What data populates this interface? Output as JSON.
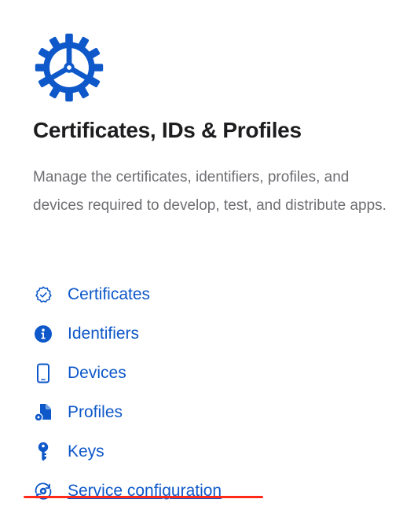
{
  "header": {
    "icon": "gear-icon",
    "title": "Certificates, IDs & Profiles",
    "description": "Manage the certificates, identifiers, profiles, and devices required to develop, test, and distribute apps."
  },
  "nav": {
    "items": [
      {
        "label": "Certificates",
        "icon": "certificate-badge-icon"
      },
      {
        "label": "Identifiers",
        "icon": "info-circle-icon"
      },
      {
        "label": "Devices",
        "icon": "phone-icon"
      },
      {
        "label": "Profiles",
        "icon": "profile-document-icon"
      },
      {
        "label": "Keys",
        "icon": "key-icon"
      },
      {
        "label": "Service configuration",
        "icon": "service-configuration-icon"
      }
    ],
    "active_item": "Service configuration"
  },
  "colors": {
    "link": "#0e58c9",
    "title": "#1d1d1f",
    "description": "#6e6e73",
    "annotation_underline": "#ff2a1a"
  }
}
